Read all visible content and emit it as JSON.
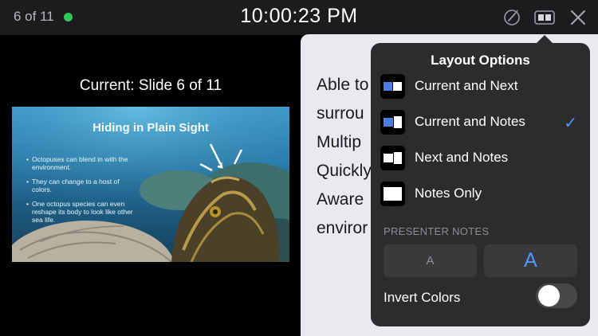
{
  "topbar": {
    "slide_counter": "6 of 11",
    "clock": "10:00:23 PM",
    "icons": [
      "pointer-icon",
      "layout-icon",
      "close-icon"
    ],
    "live_color": "#33c759"
  },
  "current": {
    "label": "Current: Slide 6 of 11",
    "slide": {
      "title": "Hiding in Plain Sight",
      "bullets": [
        "Octopuses can blend in with the environment.",
        "They can change to a host of colors.",
        "One octopus species can even reshape its body to look like other sea life."
      ]
    }
  },
  "notes": {
    "lines": [
      "Able to",
      "surrou",
      "Multip",
      "Quickly",
      "Aware",
      "enviror"
    ]
  },
  "popover": {
    "title": "Layout Options",
    "options": [
      {
        "label": "Current and Next",
        "selected": false
      },
      {
        "label": "Current and Notes",
        "selected": true
      },
      {
        "label": "Next and Notes",
        "selected": false
      },
      {
        "label": "Notes Only",
        "selected": false
      }
    ],
    "check": "✓",
    "section": "PRESENTER NOTES",
    "font_small": "A",
    "font_large": "A",
    "invert_label": "Invert Colors",
    "invert_on": false
  },
  "colors": {
    "accent": "#4a9bff",
    "panel": "#2c2c2e",
    "notes_bg": "#e9e9ee"
  }
}
